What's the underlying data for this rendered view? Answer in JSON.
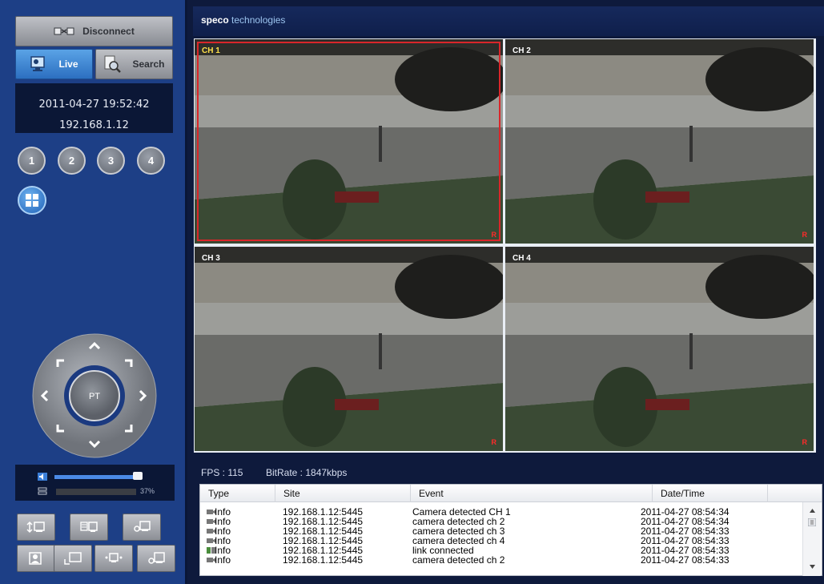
{
  "sidebar": {
    "disconnect_label": "Disconnect",
    "live_label": "Live",
    "search_label": "Search",
    "datetime": "2011-04-27 19:52:42",
    "ip": "192.168.1.12",
    "channels": [
      "1",
      "2",
      "3",
      "4"
    ],
    "ptz_label": "PT",
    "volume_percent": "37%",
    "volume_level": 0.95
  },
  "header": {
    "brand_bold": "speco",
    "brand_light": "technologies"
  },
  "cameras": [
    {
      "label": "CH 1",
      "rec": "R"
    },
    {
      "label": "CH 2",
      "rec": "R"
    },
    {
      "label": "CH 3",
      "rec": "R"
    },
    {
      "label": "CH 4",
      "rec": "R"
    }
  ],
  "stats": {
    "fps": "FPS : 115",
    "bitrate": "BitRate : 1847kbps"
  },
  "log": {
    "columns": [
      "Type",
      "Site",
      "Event",
      "Date/Time"
    ],
    "rows": [
      {
        "type": "Info",
        "site": "192.168.1.12:5445",
        "event": "Camera detected CH 1",
        "time": "2011-04-27 08:54:34"
      },
      {
        "type": "Info",
        "site": "192.168.1.12:5445",
        "event": "camera detected ch 2",
        "time": "2011-04-27 08:54:34"
      },
      {
        "type": "Info",
        "site": "192.168.1.12:5445",
        "event": "camera detected ch 3",
        "time": "2011-04-27 08:54:33"
      },
      {
        "type": "Info",
        "site": "192.168.1.12:5445",
        "event": "camera detected ch 4",
        "time": "2011-04-27 08:54:33"
      },
      {
        "type": "Info",
        "site": "192.168.1.12:5445",
        "event": "link connected",
        "time": "2011-04-27 08:54:33"
      },
      {
        "type": "Info",
        "site": "192.168.1.12:5445",
        "event": "camera detected ch 2",
        "time": "2011-04-27 08:54:33"
      }
    ]
  }
}
